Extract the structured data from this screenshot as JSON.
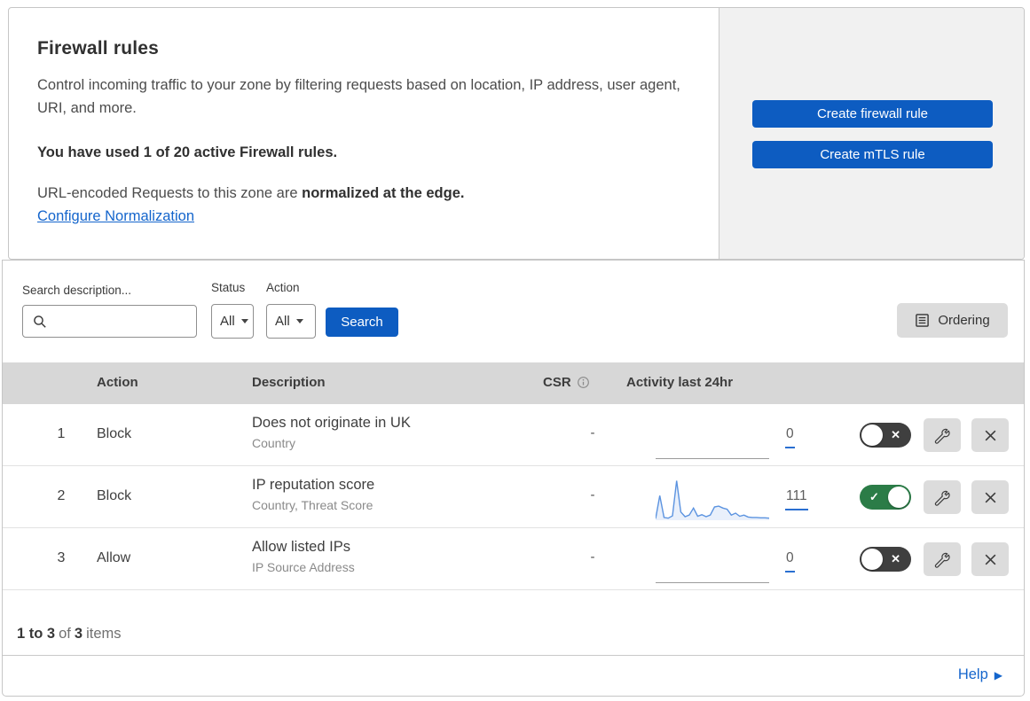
{
  "colors": {
    "primary_button": "#0d5cc1",
    "link": "#1465cc",
    "toggle_on": "#2b7c47",
    "toggle_off": "#3f3f3f",
    "table_header_bg": "#d7d7d7",
    "side_panel_bg": "#f1f1f1",
    "sparkline_line": "#5b93e0",
    "sparkline_fill": "#e9f0fb",
    "count_underline": "#2a6fd1"
  },
  "header": {
    "title": "Firewall rules",
    "description": "Control incoming traffic to your zone by filtering requests based on location, IP address, user agent, URI, and more.",
    "usage": "You have used 1 of 20 active Firewall rules.",
    "normalization_text": "URL-encoded Requests to this zone are",
    "normalization_bold": "normalized at the edge.",
    "normalization_link": "Configure Normalization",
    "create_firewall_label": "Create firewall rule",
    "create_mtls_label": "Create mTLS rule"
  },
  "filters": {
    "search_label": "Search description...",
    "search_value": "",
    "status_label": "Status",
    "status_value": "All",
    "action_label": "Action",
    "action_value": "All",
    "search_button_label": "Search",
    "ordering_button_label": "Ordering"
  },
  "table": {
    "columns": {
      "action": "Action",
      "description": "Description",
      "csr": "CSR",
      "activity": "Activity last 24hr"
    },
    "rows": [
      {
        "num": "1",
        "action": "Block",
        "description": "Does not originate in UK",
        "criteria": "Country",
        "csr": "-",
        "activity_count": "0",
        "enabled": false
      },
      {
        "num": "2",
        "action": "Block",
        "description": "IP reputation score",
        "criteria": "Country, Threat Score",
        "csr": "-",
        "activity_count": "111",
        "enabled": true
      },
      {
        "num": "3",
        "action": "Allow",
        "description": "Allow listed IPs",
        "criteria": "IP Source Address",
        "csr": "-",
        "activity_count": "0",
        "enabled": false
      }
    ]
  },
  "pagination": {
    "range": "1 to 3",
    "of": "of",
    "total": "3",
    "items": "items"
  },
  "help": {
    "label": "Help"
  },
  "icons": {
    "toggle_on_glyph": "✓",
    "toggle_off_glyph": "✕",
    "help_arrow": "▶"
  },
  "chart_data": {
    "type": "area",
    "name": "Rule 2 activity sparkline",
    "title": "Activity last 24hr",
    "total_events": 111,
    "x": "last 24 hours",
    "ylim": [
      0,
      100
    ],
    "values": [
      3,
      62,
      6,
      4,
      10,
      100,
      20,
      8,
      12,
      30,
      9,
      13,
      8,
      12,
      33,
      35,
      30,
      27,
      12,
      17,
      9,
      12,
      7,
      6,
      6,
      5,
      5,
      4
    ]
  }
}
